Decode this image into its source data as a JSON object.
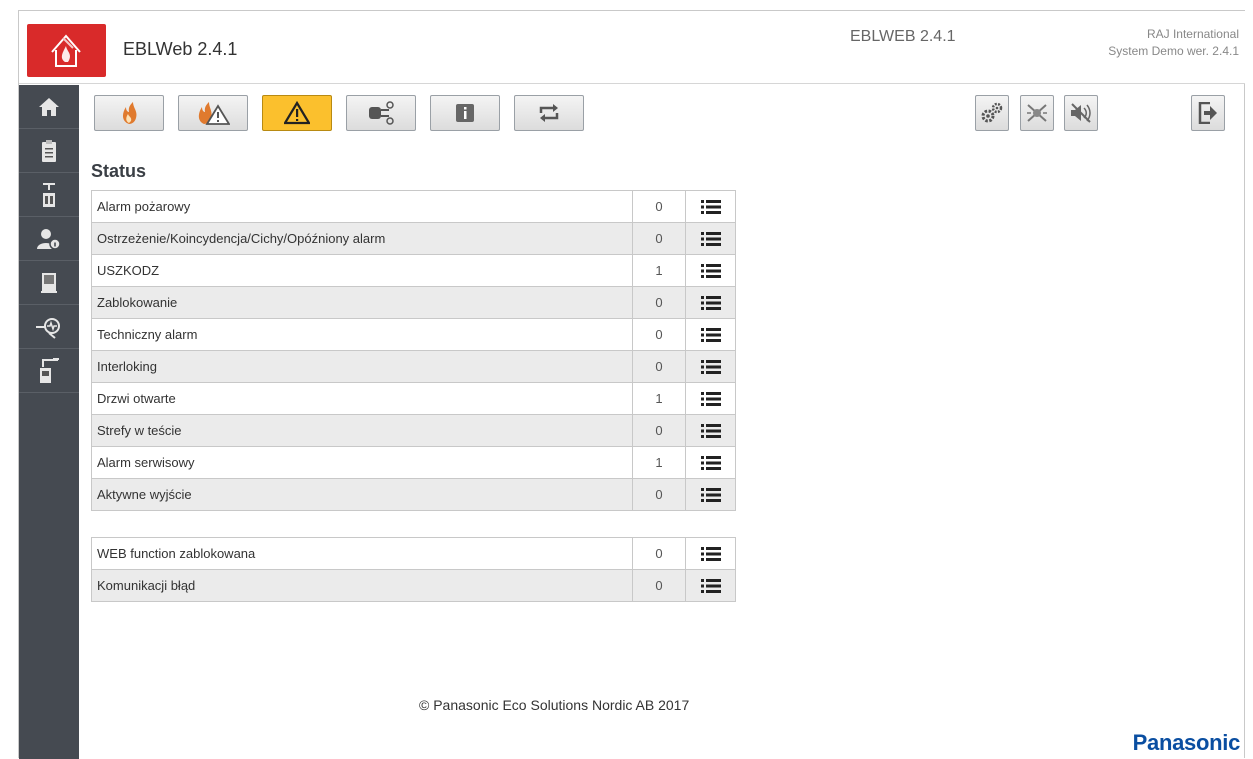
{
  "header": {
    "app_title": "EBLWeb 2.4.1",
    "version_label": "EBLWEB 2.4.1",
    "company_line1": "RAJ International",
    "company_line2": "System Demo wer. 2.4.1"
  },
  "sidebar": {
    "items": [
      {
        "icon": "home-icon"
      },
      {
        "icon": "clipboard-icon"
      },
      {
        "icon": "panel-icon"
      },
      {
        "icon": "user-info-icon"
      },
      {
        "icon": "monitor-icon"
      },
      {
        "icon": "detector-icon"
      },
      {
        "icon": "output-device-icon"
      }
    ]
  },
  "toolbar": {
    "buttons": [
      {
        "icon": "fire-icon",
        "active": false
      },
      {
        "icon": "fire-warning-icon",
        "active": false
      },
      {
        "icon": "warning-icon",
        "active": true
      },
      {
        "icon": "settings-device-icon",
        "active": false
      },
      {
        "icon": "info-icon",
        "active": false
      },
      {
        "icon": "refresh-icon",
        "active": false
      }
    ],
    "right_buttons": [
      {
        "icon": "gears-icon"
      },
      {
        "icon": "disable-detector-icon"
      },
      {
        "icon": "mute-sound-icon"
      },
      {
        "icon": "logout-icon"
      }
    ],
    "active_color": "#fbc02d"
  },
  "status": {
    "title": "Status",
    "rows": [
      {
        "label": "Alarm pożarowy",
        "count": "0"
      },
      {
        "label": "Ostrzeżenie/Koincydencja/Cichy/Opóźniony alarm",
        "count": "0"
      },
      {
        "label": "USZKODZ",
        "count": "1"
      },
      {
        "label": "Zablokowanie",
        "count": "0"
      },
      {
        "label": "Techniczny alarm",
        "count": "0"
      },
      {
        "label": "Interloking",
        "count": "0"
      },
      {
        "label": "Drzwi otwarte",
        "count": "1"
      },
      {
        "label": "Strefy w teście",
        "count": "0"
      },
      {
        "label": "Alarm serwisowy",
        "count": "1"
      },
      {
        "label": "Aktywne wyjście",
        "count": "0"
      }
    ],
    "rows2": [
      {
        "label": "WEB function zablokowana",
        "count": "0"
      },
      {
        "label": "Komunikacji błąd",
        "count": "0"
      }
    ]
  },
  "footer": {
    "copyright": "© Panasonic Eco Solutions Nordic AB 2017",
    "brand": "Panasonic",
    "brand_color": "#0a4ea1"
  }
}
